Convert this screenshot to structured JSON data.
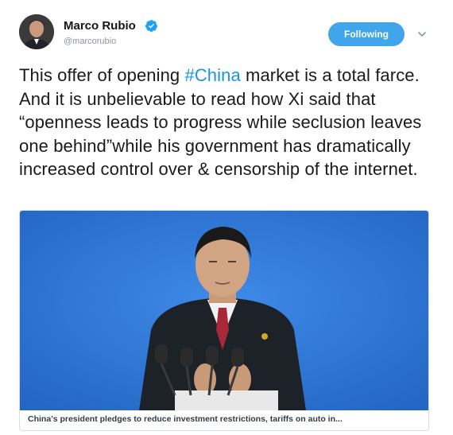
{
  "header": {
    "display_name": "Marco Rubio",
    "handle": "@marcorubio",
    "follow_label": "Following",
    "verified_icon": "verified-badge-icon",
    "menu_icon": "chevron-down-icon"
  },
  "tweet": {
    "text_before": "This offer of opening ",
    "hashtag": "#China",
    "text_after": " market is a total farce. And it is unbelievable to read how Xi said that “openness leads to progress while seclusion leaves one behind”while his government has dramatically increased control over & censorship of the internet."
  },
  "media": {
    "caption": "China’s president pledges to reduce investment restrictions, tariffs on auto in..."
  },
  "colors": {
    "accent": "#41a5ec",
    "hashtag": "#1b95e0",
    "handle": "#8899a6",
    "media_background": "#2f75d6"
  }
}
